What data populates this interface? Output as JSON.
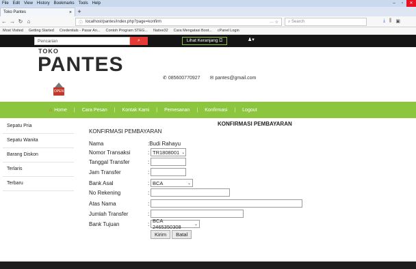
{
  "browser": {
    "menu": [
      "File",
      "Edit",
      "View",
      "History",
      "Bookmarks",
      "Tools",
      "Help"
    ],
    "tab_title": "Toko Pantes",
    "url": "localhost/pantes/index.php?page=konfirm",
    "search_placeholder": "Search",
    "bookmarks": [
      "Most Visited",
      "Getting Started",
      "Credentials - Pasar An...",
      "Contoh Program STEG...",
      "Native32",
      "Cara Mengatasi Boot...",
      "cPanel Login"
    ]
  },
  "topbar": {
    "search_placeholder": "Pencarian",
    "cart_label": "Lihat Keranjang"
  },
  "logo": {
    "toko": "TOKO",
    "name": "PANTES",
    "badge": "OPEN"
  },
  "contact": {
    "phone": "085600770927",
    "email": "pantes@gmail.com"
  },
  "nav": {
    "items": [
      "Home",
      "Cara Pesan",
      "Kontak Kami",
      "Pemesanan",
      "Konfirmasi",
      "Logout"
    ]
  },
  "sidebar": {
    "items": [
      "Sepatu Pria",
      "Sepatu Wanita",
      "Barang Diskon",
      "Terlaris",
      "Terbaru"
    ]
  },
  "form": {
    "heading": "KONFIRMASI PEMBAYARAN",
    "title": "KONFIRMASI PEMBAYARAN",
    "labels": {
      "nama": "Nama",
      "nomor_transaksi": "Nomor Transaksi",
      "tanggal_transfer": "Tanggal Transfer",
      "jam_transfer": "Jam Transfer",
      "bank_asal": "Bank Asal",
      "no_rekening": "No Rekening",
      "atas_nama": "Atas Nama",
      "jumlah_transfer": "Jumlah Transfer",
      "bank_tujuan": "Bank Tujuan"
    },
    "values": {
      "nama": ":Budi Rahayu",
      "nomor_transaksi": "TR1808001",
      "bank_asal": "BCA",
      "bank_tujuan": "BCA 2465350308"
    },
    "colon": ":",
    "buttons": {
      "submit": "Kirim",
      "cancel": "Batal"
    }
  },
  "colors": {
    "nav_green": "#8cc63f",
    "search_red": "#e53935",
    "topbar_black": "#151515"
  }
}
